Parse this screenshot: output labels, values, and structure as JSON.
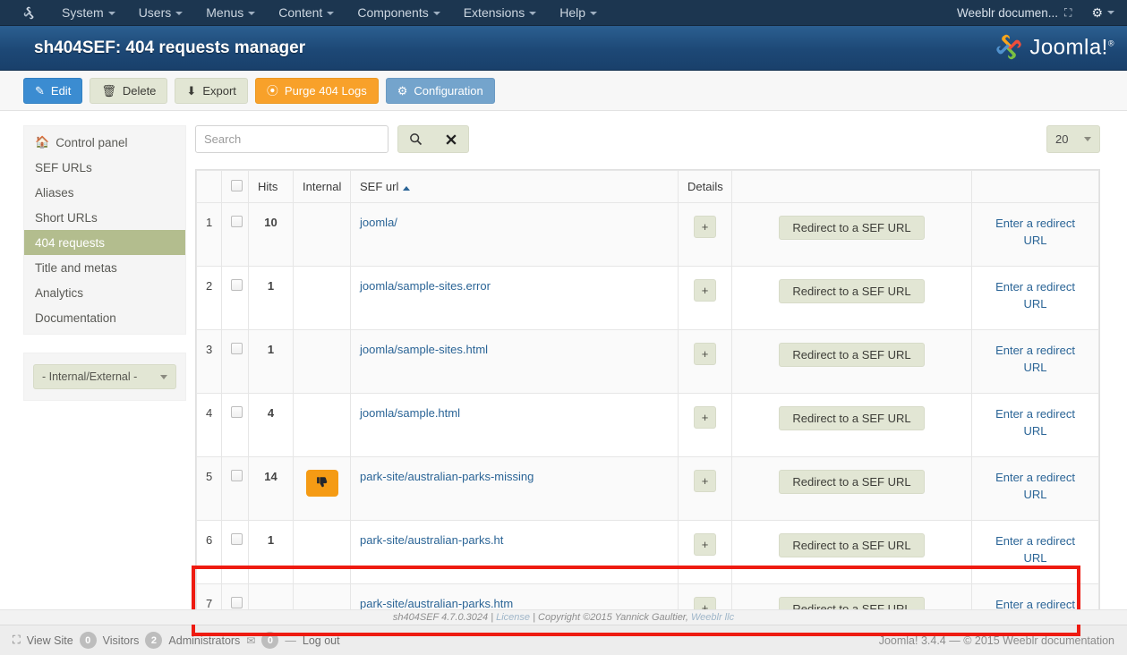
{
  "topbar": {
    "logo_icon": "joomla-logo-icon",
    "menu": [
      {
        "label": "System",
        "has_caret": true
      },
      {
        "label": "Users",
        "has_caret": true
      },
      {
        "label": "Menus",
        "has_caret": true
      },
      {
        "label": "Content",
        "has_caret": true
      },
      {
        "label": "Components",
        "has_caret": true
      },
      {
        "label": "Extensions",
        "has_caret": true
      },
      {
        "label": "Help",
        "has_caret": true
      }
    ],
    "site_name": "Weeblr documen...",
    "external_link_icon": "external-link-icon",
    "gear_icon": "gear-icon"
  },
  "header": {
    "title": "sh404SEF: 404 requests manager",
    "brand": "Joomla!",
    "brand_sup": "®",
    "brand_logo_icon": "joomla-brand-icon"
  },
  "toolbar": {
    "buttons": [
      {
        "label": "Edit",
        "icon": "edit-pencil-icon",
        "glyph": "✎",
        "style": "btn-edit"
      },
      {
        "label": "Delete",
        "icon": "trash-icon",
        "glyph": "🗑",
        "style": "btn-plain"
      },
      {
        "label": "Export",
        "icon": "download-icon",
        "glyph": "⬇",
        "style": "btn-plain"
      },
      {
        "label": "Purge 404 Logs",
        "icon": "purge-circle-icon",
        "glyph": "⦿",
        "style": "btn-warn"
      },
      {
        "label": "Configuration",
        "icon": "gear-icon",
        "glyph": "⚙",
        "style": "btn-config"
      }
    ]
  },
  "sidebar": {
    "items": [
      {
        "label": "Control panel",
        "icon": "home-icon",
        "active": false
      },
      {
        "label": "SEF URLs",
        "icon": "",
        "active": false
      },
      {
        "label": "Aliases",
        "icon": "",
        "active": false
      },
      {
        "label": "Short URLs",
        "icon": "",
        "active": false
      },
      {
        "label": "404 requests",
        "icon": "",
        "active": true
      },
      {
        "label": "Title and metas",
        "icon": "",
        "active": false
      },
      {
        "label": "Analytics",
        "icon": "",
        "active": false
      },
      {
        "label": "Documentation",
        "icon": "",
        "active": false
      }
    ],
    "filter": {
      "selected": "- Internal/External -",
      "caret_icon": "chevron-down-icon"
    }
  },
  "search": {
    "value": "",
    "placeholder": "Search",
    "search_icon": "search-icon",
    "clear_icon": "clear-x-icon"
  },
  "limit": {
    "value": "20",
    "caret_icon": "chevron-down-icon"
  },
  "table": {
    "headers": {
      "num": "",
      "checkbox": "select-all-checkbox",
      "hits": "Hits",
      "internal": "Internal",
      "sef_url": "SEF url",
      "sort_indicator": "sort-ascending-icon",
      "details": "Details",
      "action": "",
      "redirect": ""
    },
    "expand_label": "+",
    "redirect_button_label": "Redirect to a SEF URL",
    "enter_redirect_label": "Enter a redirect URL",
    "internal_icon": "thumbs-down-icon",
    "internal_glyph": "👎",
    "rows": [
      {
        "num": "1",
        "hits": "10",
        "internal": false,
        "url": "joomla/",
        "highlighted": false
      },
      {
        "num": "2",
        "hits": "1",
        "internal": false,
        "url": "joomla/sample-sites.error",
        "highlighted": false
      },
      {
        "num": "3",
        "hits": "1",
        "internal": false,
        "url": "joomla/sample-sites.html",
        "highlighted": false
      },
      {
        "num": "4",
        "hits": "4",
        "internal": false,
        "url": "joomla/sample.html",
        "highlighted": false
      },
      {
        "num": "5",
        "hits": "14",
        "internal": true,
        "url": "park-site/australian-parks-missing",
        "highlighted": true
      },
      {
        "num": "6",
        "hits": "1",
        "internal": false,
        "url": "park-site/australian-parks.ht",
        "highlighted": false
      },
      {
        "num": "7",
        "hits": "",
        "internal": false,
        "url": "park-site/australian-parks.htm",
        "highlighted": false
      }
    ]
  },
  "content_footer": {
    "version": "sh404SEF 4.7.0.3024",
    "sep1": "|",
    "license": "License",
    "sep2": "|",
    "copyright": "Copyright ©2015 Yannick Gaultier,",
    "vendor": "Weeblr llc"
  },
  "statusbar": {
    "view_site_icon": "external-link-icon",
    "view_site": "View Site",
    "visitors_count": "0",
    "visitors_label": "Visitors",
    "admins_count": "2",
    "admins_label": "Administrators",
    "mail_icon": "mail-icon",
    "messages_count": "0",
    "dash": "—",
    "logout": "Log out",
    "right_text": "Joomla! 3.4.4  —  © 2015 Weeblr documentation"
  },
  "colors": {
    "accent_blue": "#3b8cd1",
    "warn_orange": "#f8a12a",
    "sidebar_active": "#b3bd8e",
    "pill_olive": "#e2e6d4",
    "highlight_red": "#ee1b11",
    "link_blue": "#2a6496",
    "header_blue": "#1d4876",
    "topbar_navy": "#1c3650"
  }
}
